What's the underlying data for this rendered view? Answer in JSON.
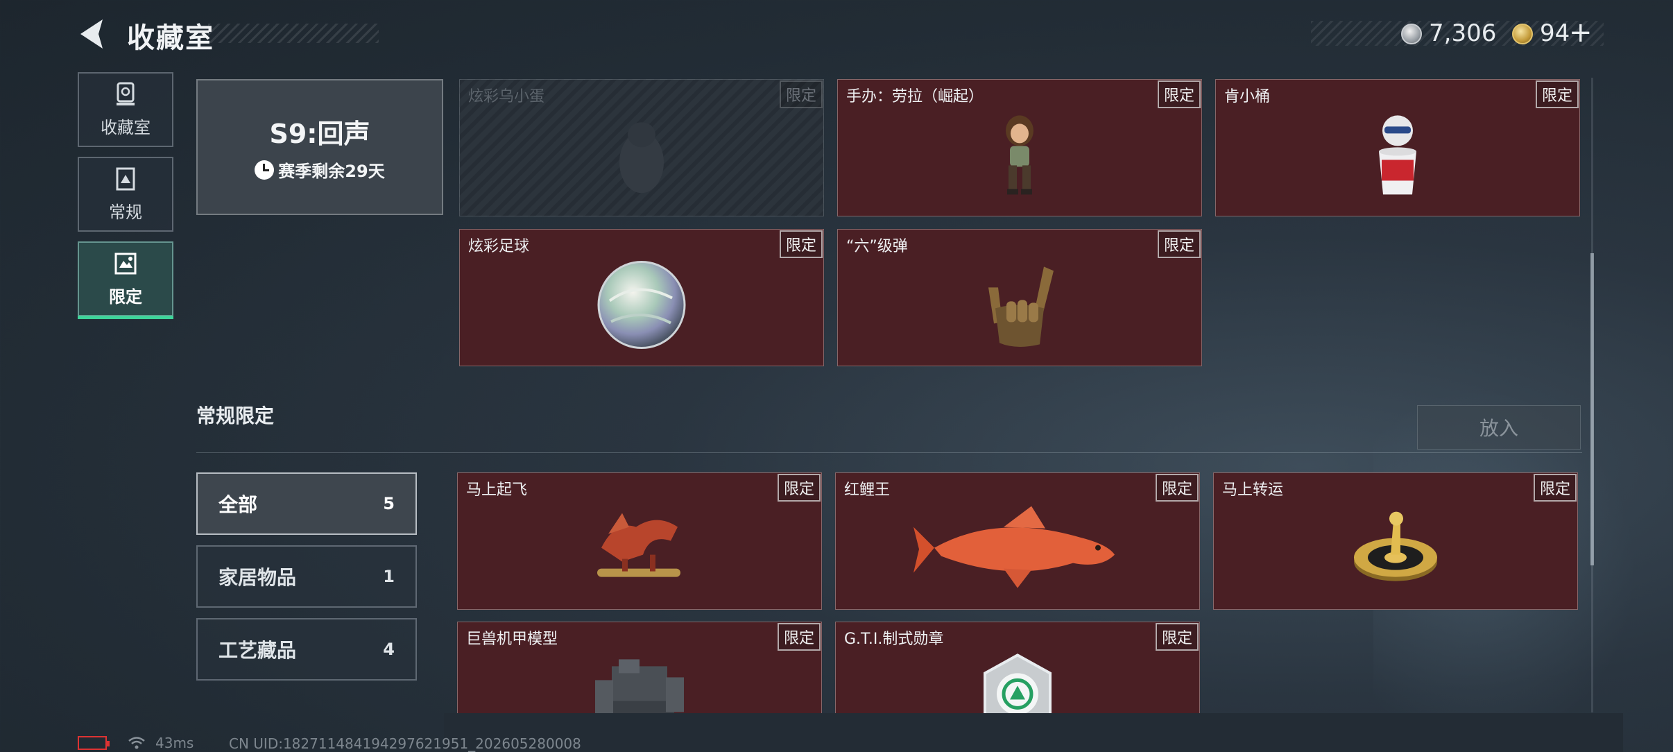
{
  "header": {
    "title": "收藏室",
    "silver_amount": "7,306",
    "gold_amount": "94",
    "plus_label": "+"
  },
  "nav": {
    "items": [
      {
        "label": "收藏室",
        "icon": "trophy-icon"
      },
      {
        "label": "常规",
        "icon": "card-icon"
      },
      {
        "label": "限定",
        "icon": "limited-icon",
        "active": true
      }
    ]
  },
  "season": {
    "name": "S9:回声",
    "remaining": "赛季剩余29天"
  },
  "season_items": [
    {
      "name": "炫彩乌小蛋",
      "badge": "限定",
      "locked": true
    },
    {
      "name": "手办：劳拉（崛起）",
      "badge": "限定"
    },
    {
      "name": "肯小桶",
      "badge": "限定"
    },
    {
      "name": "炫彩足球",
      "badge": "限定"
    },
    {
      "name": "“六”级弹",
      "badge": "限定"
    }
  ],
  "regular_section": {
    "title": "常规限定",
    "put_in_label": "放入"
  },
  "filters": [
    {
      "label": "全部",
      "count": "5",
      "active": true
    },
    {
      "label": "家居物品",
      "count": "1"
    },
    {
      "label": "工艺藏品",
      "count": "4"
    }
  ],
  "regular_items": [
    {
      "name": "马上起飞",
      "badge": "限定"
    },
    {
      "name": "红鲤王",
      "badge": "限定"
    },
    {
      "name": "马上转运",
      "badge": "限定"
    },
    {
      "name": "巨兽机甲模型",
      "badge": "限定"
    },
    {
      "name": "G.T.I.制式勋章",
      "badge": "限定"
    }
  ],
  "status": {
    "ping": "43ms",
    "uid": "CN UID:18271148419429762195‌1_202605280008"
  },
  "colors": {
    "card_bg": "#4a1f24",
    "accent_green": "#3ed49a",
    "battery_red": "#dd3333"
  }
}
